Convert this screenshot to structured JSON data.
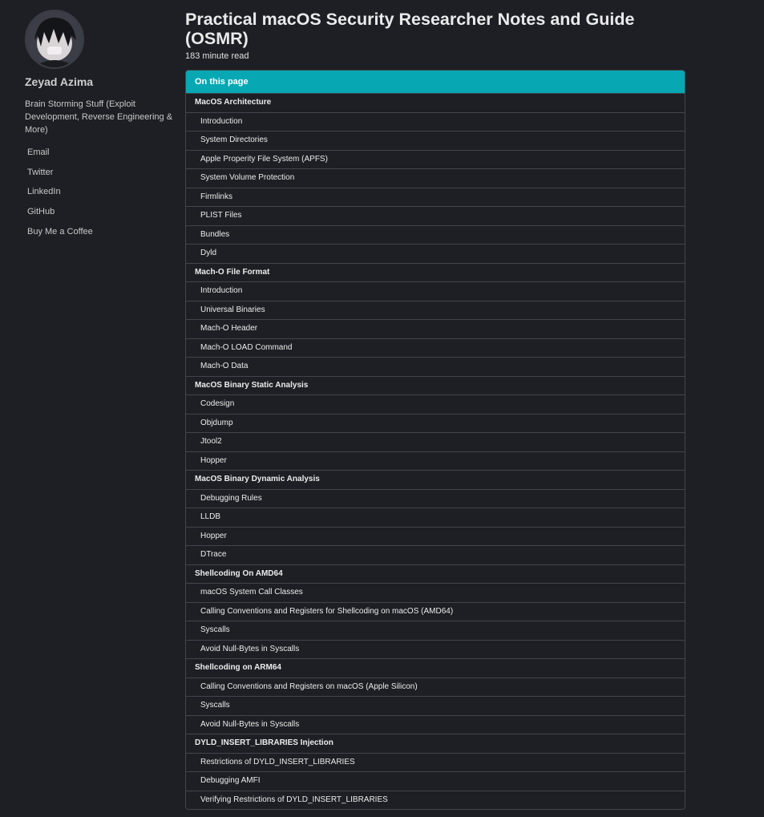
{
  "profile": {
    "name": "Zeyad Azima",
    "bio": "Brain Storming Stuff (Exploit Development, Reverse Engineering & More)",
    "links": [
      "Email",
      "Twitter",
      "LinkedIn",
      "GitHub",
      "Buy Me a Coffee"
    ]
  },
  "post": {
    "title": "Practical macOS Security Researcher Notes and Guide (OSMR)",
    "read_time": "183 minute read"
  },
  "toc": {
    "header": "On this page",
    "items": [
      {
        "label": "MacOS Architecture",
        "level": 1
      },
      {
        "label": "Introduction",
        "level": 2
      },
      {
        "label": "System Directories",
        "level": 2
      },
      {
        "label": "Apple Properity File System (APFS)",
        "level": 2
      },
      {
        "label": "System Volume Protection",
        "level": 2
      },
      {
        "label": "Firmlinks",
        "level": 2
      },
      {
        "label": "PLIST Files",
        "level": 2
      },
      {
        "label": "Bundles",
        "level": 2
      },
      {
        "label": "Dyld",
        "level": 2
      },
      {
        "label": "Mach-O File Format",
        "level": 1
      },
      {
        "label": "Introduction",
        "level": 2
      },
      {
        "label": "Universal Binaries",
        "level": 2
      },
      {
        "label": "Mach-O Header",
        "level": 2
      },
      {
        "label": "Mach-O LOAD Command",
        "level": 2
      },
      {
        "label": "Mach-O Data",
        "level": 2
      },
      {
        "label": "MacOS Binary Static Analysis",
        "level": 1
      },
      {
        "label": "Codesign",
        "level": 2
      },
      {
        "label": "Objdump",
        "level": 2
      },
      {
        "label": "Jtool2",
        "level": 2
      },
      {
        "label": "Hopper",
        "level": 2
      },
      {
        "label": "MacOS Binary Dynamic Analysis",
        "level": 1
      },
      {
        "label": "Debugging Rules",
        "level": 2
      },
      {
        "label": "LLDB",
        "level": 2
      },
      {
        "label": "Hopper",
        "level": 2
      },
      {
        "label": "DTrace",
        "level": 2
      },
      {
        "label": "Shellcoding On AMD64",
        "level": 1
      },
      {
        "label": "macOS System Call Classes",
        "level": 2
      },
      {
        "label": "Calling Conventions and Registers for Shellcoding on macOS (AMD64)",
        "level": 2
      },
      {
        "label": "Syscalls",
        "level": 2
      },
      {
        "label": "Avoid Null-Bytes in Syscalls",
        "level": 2
      },
      {
        "label": "Shellcoding on ARM64",
        "level": 1
      },
      {
        "label": "Calling Conventions and Registers on macOS (Apple Silicon)",
        "level": 2
      },
      {
        "label": "Syscalls",
        "level": 2
      },
      {
        "label": "Avoid Null-Bytes in Syscalls",
        "level": 2
      },
      {
        "label": "DYLD_INSERT_LIBRARIES Injection",
        "level": 1
      },
      {
        "label": "Restrictions of DYLD_INSERT_LIBRARIES",
        "level": 2
      },
      {
        "label": "Debugging AMFI",
        "level": 2
      },
      {
        "label": "Verifying Restrictions of DYLD_INSERT_LIBRARIES",
        "level": 2
      }
    ]
  },
  "colors": {
    "background": "#1d1f24",
    "toc_header": "#07a8b4",
    "border": "#41454c"
  }
}
